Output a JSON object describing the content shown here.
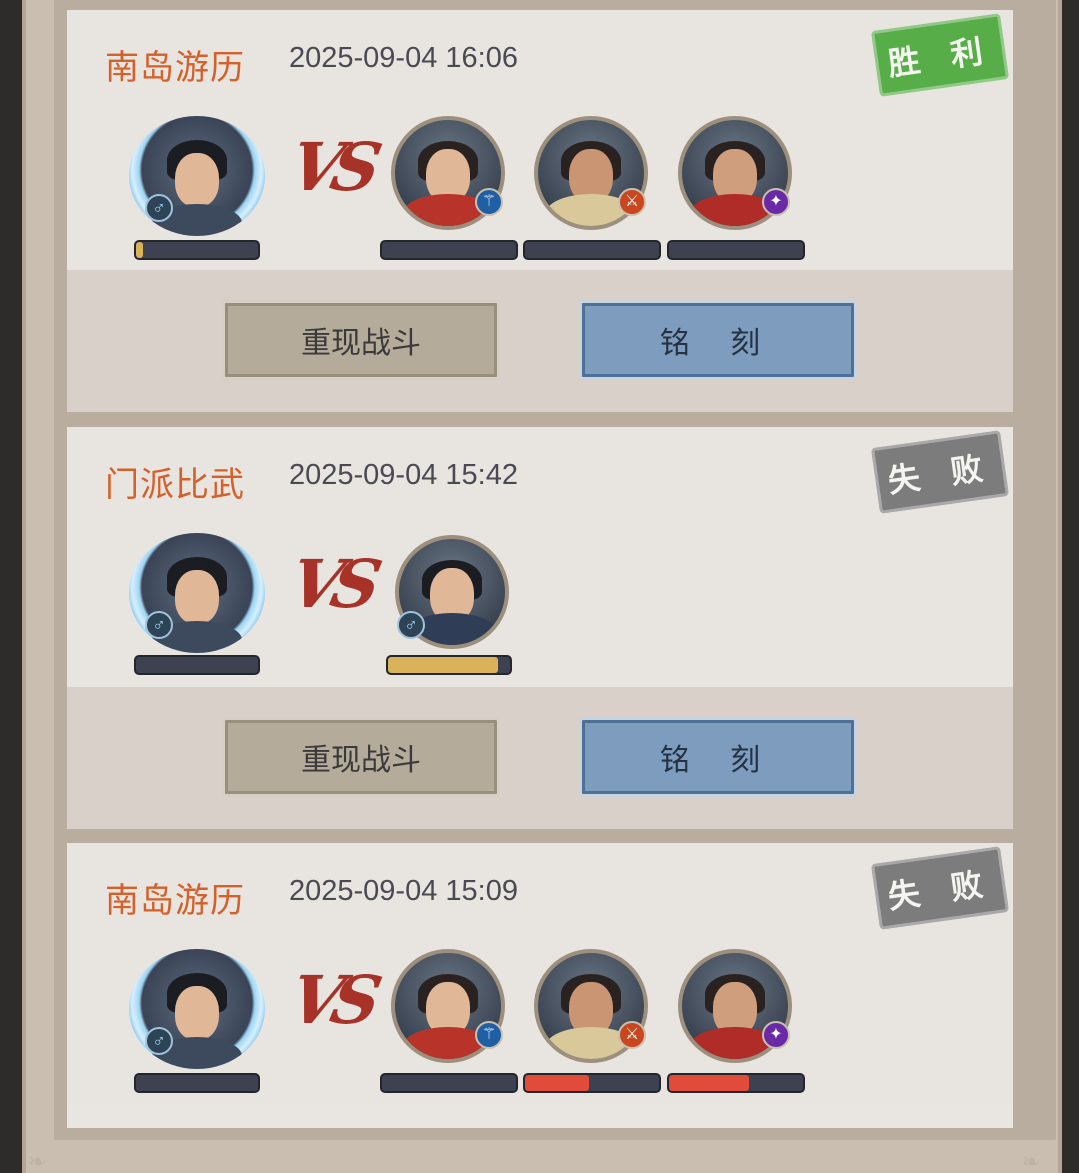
{
  "buttons": {
    "replay": "重现战斗",
    "engrave": "铭 刻"
  },
  "icons": {
    "gender": "male-icon",
    "vs": "vs-emblem"
  },
  "colors": {
    "mode_title": "#d4602a",
    "win_stamp": "#57ad47",
    "lose_stamp": "#7c7c7c",
    "hp_gold": "#d9b25a",
    "hp_red": "#e04b3a"
  },
  "records": [
    {
      "mode": "南岛游历",
      "time": "2025-09-04 16:06",
      "result": "胜 利",
      "result_type": "win",
      "player": {
        "hp_fraction": 0.06
      },
      "opponents": [
        {
          "hp_fraction": 0,
          "class_icon": "blue-trident-icon"
        },
        {
          "hp_fraction": 0,
          "class_icon": "orange-blade-icon"
        },
        {
          "hp_fraction": 0,
          "class_icon": "purple-staff-icon"
        }
      ]
    },
    {
      "mode": "门派比武",
      "time": "2025-09-04 15:42",
      "result": "失 败",
      "result_type": "lose",
      "player": {
        "hp_fraction": 0
      },
      "opponents": [
        {
          "hp_fraction": 0.9,
          "class_icon": "male-icon"
        }
      ]
    },
    {
      "mode": "南岛游历",
      "time": "2025-09-04 15:09",
      "result": "失 败",
      "result_type": "lose",
      "player": {
        "hp_fraction": 0
      },
      "opponents": [
        {
          "hp_fraction": 0,
          "class_icon": "blue-trident-icon"
        },
        {
          "hp_fraction": 0.48,
          "class_icon": "orange-blade-icon"
        },
        {
          "hp_fraction": 0.6,
          "class_icon": "purple-staff-icon"
        }
      ]
    }
  ]
}
